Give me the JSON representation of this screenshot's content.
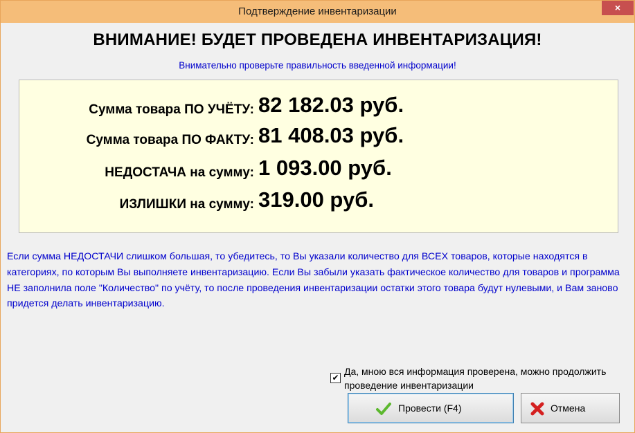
{
  "window": {
    "title": "Подтверждение инвентаризации",
    "close_label": "×"
  },
  "heading": "ВНИМАНИЕ! БУДЕТ ПРОВЕДЕНА ИНВЕНТАРИЗАЦИЯ!",
  "subheading": "Внимательно проверьте правильность введенной информации!",
  "summary": {
    "rows": [
      {
        "label": "Сумма товара ПО УЧЁТУ:",
        "value": "82 182.03 руб."
      },
      {
        "label": "Сумма товара ПО ФАКТУ:",
        "value": "81 408.03 руб."
      },
      {
        "label": "НЕДОСТАЧА на сумму:",
        "value": "1 093.00 руб."
      },
      {
        "label": "ИЗЛИШКИ на сумму:",
        "value": "319.00 руб."
      }
    ]
  },
  "note": "Если сумма НЕДОСТАЧИ слишком большая, то убедитесь, то Вы указали количество для ВСЕХ товаров, которые находятся в категориях, по которым Вы выполняете инвентаризацию. Если Вы забыли указать фактическое количество для товаров и программа НЕ заполнила поле \"Количество\" по учёту, то после проведения инвентаризации остатки этого товара будут нулевыми, и Вам заново придется делать инвентаризацию.",
  "confirm_checkbox": {
    "checked": true,
    "mark": "✔",
    "label": "Да, мною вся информация проверена, можно продолжить проведение инвентаризации"
  },
  "buttons": {
    "ok_label": "Провести (F4)",
    "cancel_label": "Отмена"
  },
  "colors": {
    "title_bar": "#f5bd79",
    "close_button": "#c74f4f",
    "summary_bg": "#ffffe1",
    "info_text": "#0000cc",
    "ok_icon": "#5cb82e",
    "cancel_icon": "#d42020"
  },
  "icons": {
    "ok": "check-icon",
    "cancel": "x-icon"
  }
}
